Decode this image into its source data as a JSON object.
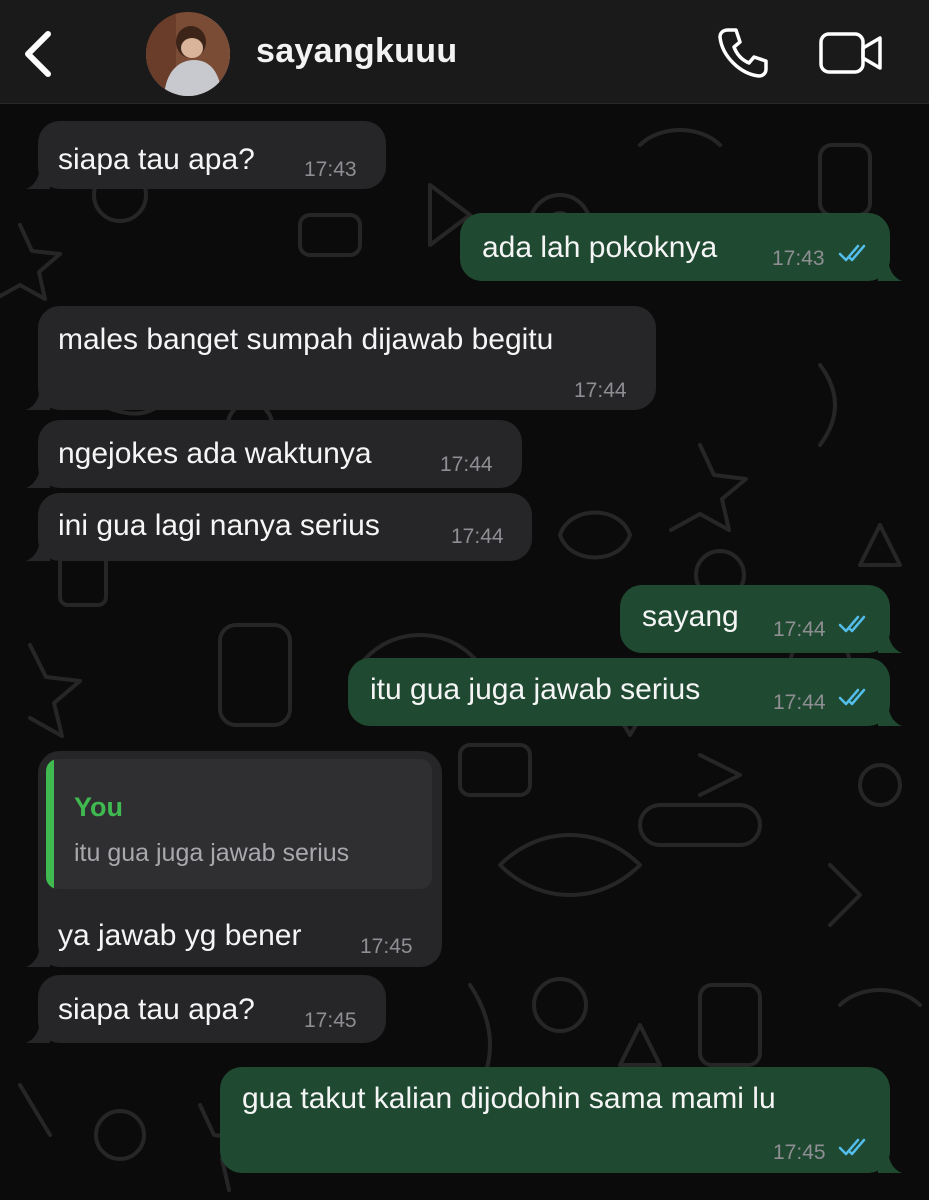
{
  "header": {
    "contact_name": "sayangkuuu",
    "icons": [
      "chevron-left-icon",
      "phone-icon",
      "video-camera-icon"
    ]
  },
  "colors": {
    "header_bg": "#1a1a1a",
    "chat_bg": "#0b0b0b",
    "incoming_bubble": "#262628",
    "outgoing_bubble": "#1f4a31",
    "timestamp": "#8e8e93",
    "read_ticks": "#53bdeb",
    "quote_accent": "#3fb950"
  },
  "messages": [
    {
      "direction": "in",
      "text": "siapa tau apa?",
      "time": "17:43"
    },
    {
      "direction": "out",
      "text": "ada lah pokoknya",
      "time": "17:43",
      "status": "read"
    },
    {
      "direction": "in",
      "text": "males banget sumpah dijawab begitu",
      "time": "17:44"
    },
    {
      "direction": "in",
      "text": "ngejokes ada waktunya",
      "time": "17:44"
    },
    {
      "direction": "in",
      "text": "ini gua lagi nanya serius",
      "time": "17:44"
    },
    {
      "direction": "out",
      "text": "sayang",
      "time": "17:44",
      "status": "read"
    },
    {
      "direction": "out",
      "text": "itu gua juga jawab serius",
      "time": "17:44",
      "status": "read"
    },
    {
      "direction": "in",
      "text": "ya jawab yg bener",
      "time": "17:45",
      "reply_to": {
        "author": "You",
        "text": "itu gua juga jawab serius"
      }
    },
    {
      "direction": "in",
      "text": "siapa tau apa?",
      "time": "17:45"
    },
    {
      "direction": "out",
      "text": "gua takut kalian dijodohin sama mami lu",
      "time": "17:45",
      "status": "read"
    }
  ]
}
